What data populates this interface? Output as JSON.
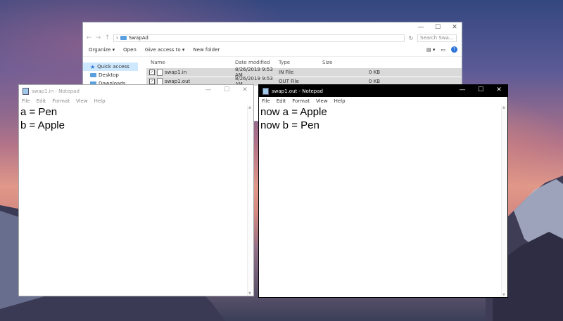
{
  "explorer": {
    "titlebar_controls": [
      "—",
      "☐",
      "✕"
    ],
    "nav_buttons": [
      "←",
      "→",
      "↑"
    ],
    "path_sep": "›",
    "path": "SwapAd",
    "search_placeholder": "Search Swa...",
    "refresh": "↻",
    "commands": [
      "Organize ▾",
      "Open",
      "Give access to ▾",
      "New folder"
    ],
    "columns": {
      "name": "Name",
      "date": "Date modified",
      "type": "Type",
      "size": "Size"
    },
    "nav": [
      {
        "label": "Quick access",
        "icon": "star-icon"
      },
      {
        "label": "Desktop",
        "icon": "desktop-folder-icon"
      },
      {
        "label": "Downloads",
        "icon": "downloads-folder-icon"
      }
    ],
    "files": [
      {
        "name": "swap1.in",
        "date": "8/26/2019 9:53 AM",
        "type": "IN File",
        "size": "0 KB"
      },
      {
        "name": "swap1.out",
        "date": "8/26/2019 9:53 AM",
        "type": "OUT File",
        "size": "0 KB"
      }
    ],
    "help": "?"
  },
  "notepad_in": {
    "title": "swap1.in - Notepad",
    "menu": [
      "File",
      "Edit",
      "Format",
      "View",
      "Help"
    ],
    "lines": [
      "a = Pen",
      "b = Apple"
    ]
  },
  "notepad_out": {
    "title": "swap1.out - Notepad",
    "menu": [
      "File",
      "Edit",
      "Format",
      "View",
      "Help"
    ],
    "lines": [
      "now a = Apple",
      "now b = Pen"
    ]
  },
  "window_controls": {
    "minimize": "—",
    "maximize": "☐",
    "close": "✕"
  }
}
